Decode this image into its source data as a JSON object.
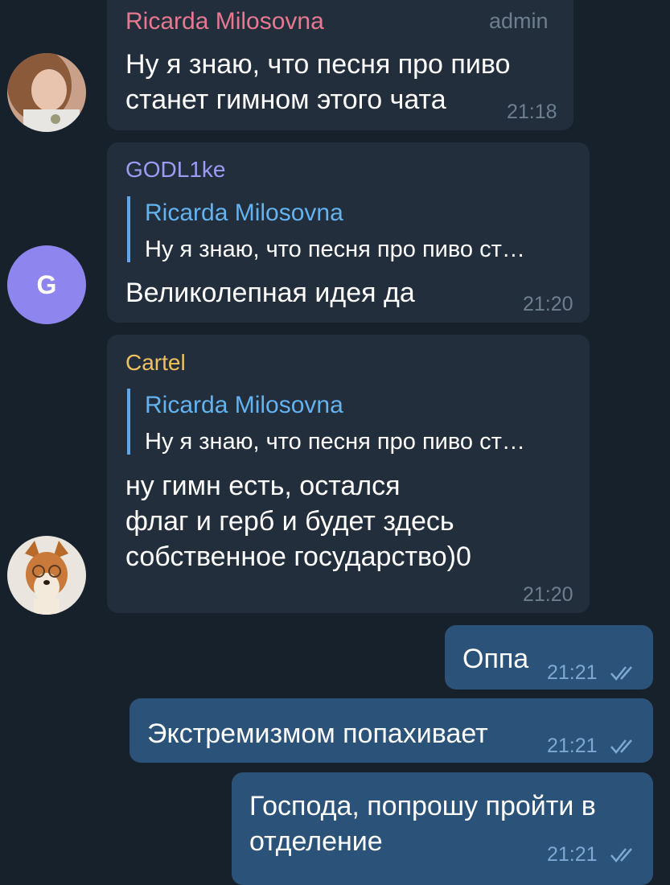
{
  "colors": {
    "background": "#17212b",
    "incoming_bubble": "#232e3c",
    "outgoing_bubble": "#2b5278",
    "ricarda_name": "#e8788f",
    "godl_name": "#9b9cf5",
    "cartel_name": "#f0c060",
    "reply_accent": "#5fa8ea"
  },
  "messages": [
    {
      "sender": "Ricarda Milosovna",
      "role": "admin",
      "text": "Ну я знаю, что песня про пиво\nстанет гимном этого чата",
      "time": "21:18"
    },
    {
      "sender": "GODL1ke",
      "avatar_letter": "G",
      "reply_name": "Ricarda Milosovna",
      "reply_text": "Ну я знаю, что песня про пиво ст…",
      "text": "Великолепная идея да",
      "time": "21:20"
    },
    {
      "sender": "Cartel",
      "reply_name": "Ricarda Milosovna",
      "reply_text": "Ну я знаю, что песня про пиво ст…",
      "text": "ну гимн есть, остался\nфлаг и герб и будет здесь\nсобственное государство)0",
      "time": "21:20"
    }
  ],
  "outgoing": [
    {
      "text": "Оппа",
      "time": "21:21",
      "status_icon": "double-check-icon"
    },
    {
      "text": "Экстремизмом попахивает",
      "time": "21:21",
      "status_icon": "double-check-icon"
    },
    {
      "text": "Господа, попрошу пройти в\nотделение",
      "time": "21:21",
      "status_icon": "double-check-icon"
    }
  ]
}
